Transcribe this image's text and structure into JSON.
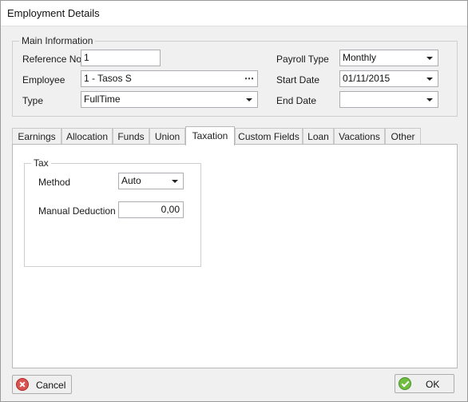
{
  "window": {
    "title": "Employment Details"
  },
  "main_info": {
    "legend": "Main Information",
    "reference_no": {
      "label": "Reference No",
      "value": "1"
    },
    "employee": {
      "label": "Employee",
      "value": "1 - Tasos S",
      "button": "⋯"
    },
    "type": {
      "label": "Type",
      "value": "FullTime"
    },
    "payroll_type": {
      "label": "Payroll Type",
      "value": "Monthly"
    },
    "start_date": {
      "label": "Start Date",
      "value": "01/11/2015"
    },
    "end_date": {
      "label": "End Date",
      "value": ""
    }
  },
  "tabs": [
    {
      "label": "Earnings"
    },
    {
      "label": "Allocation"
    },
    {
      "label": "Funds"
    },
    {
      "label": "Union"
    },
    {
      "label": "Taxation",
      "active": true
    },
    {
      "label": "Custom Fields"
    },
    {
      "label": "Loan"
    },
    {
      "label": "Vacations"
    },
    {
      "label": "Other"
    }
  ],
  "tax": {
    "legend": "Tax",
    "method": {
      "label": "Method",
      "value": "Auto"
    },
    "manual_deduction": {
      "label": "Manual Deduction",
      "value": "0,00"
    }
  },
  "buttons": {
    "cancel": "Cancel",
    "ok": "OK"
  },
  "colors": {
    "cancel_icon": "#d9534f",
    "ok_icon": "#6fbf3f"
  }
}
